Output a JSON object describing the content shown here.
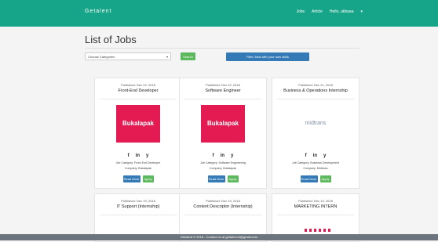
{
  "header": {
    "brand": "Getalent",
    "nav": [
      "Jobs",
      "Article",
      "Hello, akbaaa"
    ]
  },
  "page": {
    "title": "List of Jobs",
    "category_placeholder": "Choose Categories",
    "search_label": "Search",
    "filter_label": "Filter Jobs with your own skills"
  },
  "jobs": [
    {
      "published": "Published: Dec 22, 2018",
      "title": "Front-End Developer",
      "logo": "Bukalapak",
      "category": "Job Category: Front-End Developer",
      "company": "Company: Bukalapak"
    },
    {
      "published": "Published: Dec 22, 2018",
      "title": "Software Engineer",
      "logo": "Bukalapak",
      "category": "Job Category: Software Engineering",
      "company": "Company: Bukalapak"
    },
    {
      "published": "Published: Dec 21, 2018",
      "title": "Business & Operations Internship",
      "logo": "midtrans",
      "category": "Job Category: Business Development",
      "company": "Company: Midtrans"
    },
    {
      "published": "Published: Dec 19, 2018",
      "title": "IT Support (Internship)"
    },
    {
      "published": "Published: Dec 19, 2018",
      "title": "Content Descriptor (Internship)"
    },
    {
      "published": "Published: Dec 19, 2018",
      "title": "MARKETING INTERN"
    }
  ],
  "card_actions": {
    "read_more": "Read More",
    "apply": "Apply"
  },
  "socials": [
    "f",
    "in",
    "y"
  ],
  "footer": "Getalent © 2018 - Contact us at getalent.id@gmail.com",
  "colors": {
    "header": "#17a589",
    "primary": "#337ab7",
    "success": "#5cb85c",
    "brand_red": "#e41b53"
  }
}
